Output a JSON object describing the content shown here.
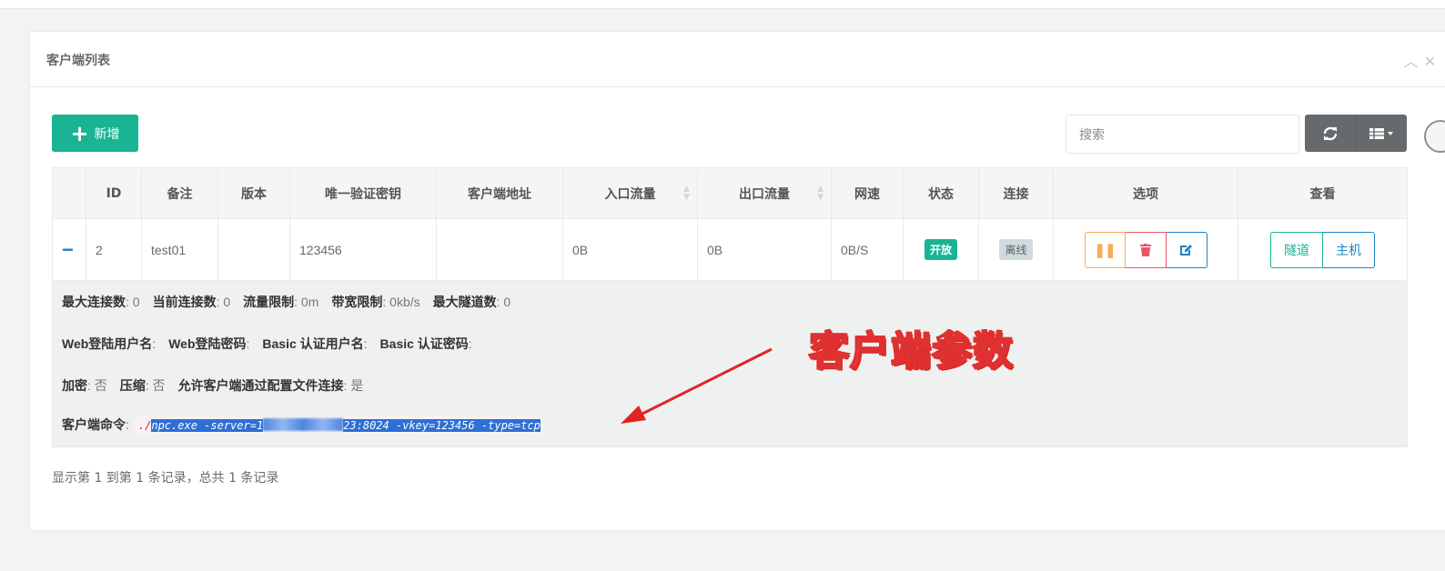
{
  "panel": {
    "title": "客户端列表",
    "tools": "^ ×"
  },
  "toolbar": {
    "add_label": "新增",
    "search_placeholder": "搜索"
  },
  "table": {
    "headers": [
      "",
      "ID",
      "备注",
      "版本",
      "唯一验证密钥",
      "客户端地址",
      "入口流量",
      "出口流量",
      "网速",
      "状态",
      "连接",
      "选项",
      "查看"
    ],
    "row": {
      "expand": "−",
      "id": "2",
      "remark": "test01",
      "version": "",
      "vkey": "123456",
      "address": "",
      "in_flow": "0B",
      "out_flow": "0B",
      "speed": "0B/S",
      "status": "开放",
      "connection": "离线",
      "view_tunnel": "隧道",
      "view_host": "主机"
    }
  },
  "detail": {
    "line1": [
      {
        "k": "最大连接数",
        "v": ": 0"
      },
      {
        "k": "当前连接数",
        "v": ": 0"
      },
      {
        "k": "流量限制",
        "v": ": 0m"
      },
      {
        "k": "带宽限制",
        "v": ": 0kb/s"
      },
      {
        "k": "最大隧道数",
        "v": ": 0"
      }
    ],
    "line2": [
      {
        "k": "Web登陆用户名",
        "v": ":"
      },
      {
        "k": "Web登陆密码",
        "v": ":"
      },
      {
        "k": "Basic 认证用户名",
        "v": ":"
      },
      {
        "k": "Basic 认证密码",
        "v": ":"
      }
    ],
    "line3": [
      {
        "k": "加密",
        "v": ": 否"
      },
      {
        "k": "压缩",
        "v": ": 否"
      },
      {
        "k": "允许客户端通过配置文件连接",
        "v": ": 是"
      }
    ],
    "cmd_label": "客户端命令",
    "cmd_colon": ":",
    "cmd_prefix": "./",
    "cmd_part1": "npc.exe -server=1",
    "cmd_part2": "23:8024 -vkey=123456 -type=tcp"
  },
  "annotation": "客户端参数",
  "footer": "显示第 1 到第 1 条记录，总共 1 条记录",
  "colors": {
    "primary": "#1ab394",
    "warning": "#f8ac59",
    "danger": "#ed5565",
    "info": "#1c84c6",
    "annotation": "#e03030"
  }
}
